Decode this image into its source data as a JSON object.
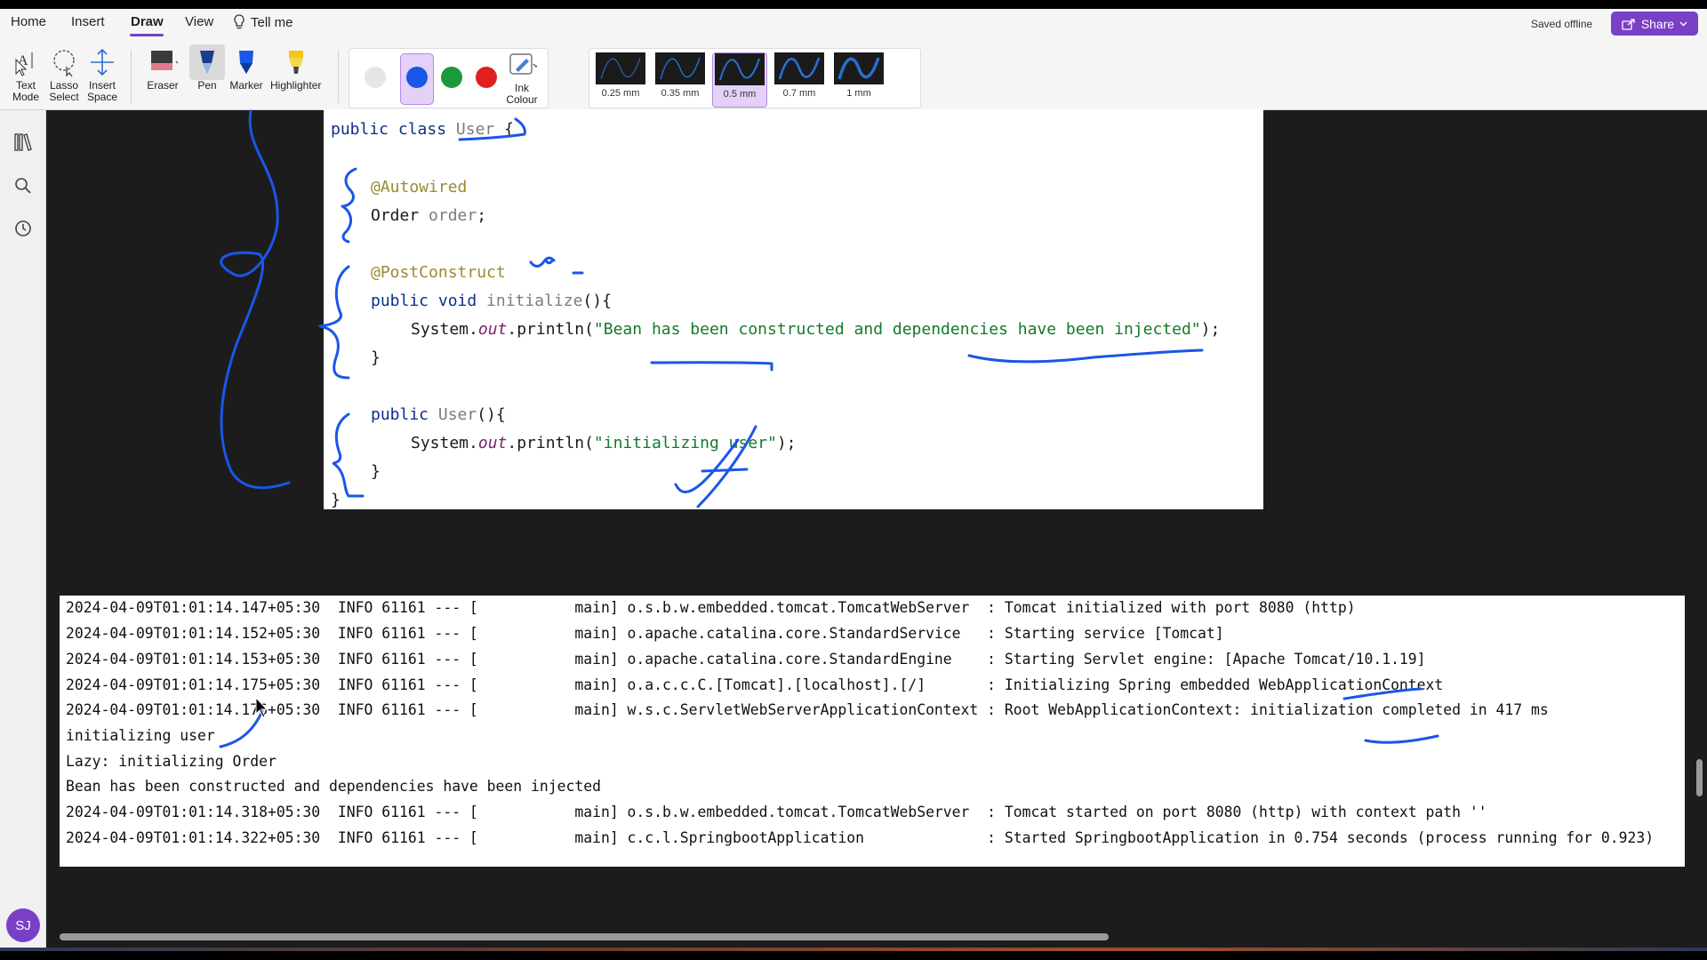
{
  "ribbon": {
    "tabs": [
      "Home",
      "Insert",
      "Draw",
      "View"
    ],
    "tell_me": "Tell me",
    "saved_status": "Saved offline",
    "share_label": "Share",
    "tools": {
      "text_mode": [
        "Text",
        "Mode"
      ],
      "lasso_select": [
        "Lasso",
        "Select"
      ],
      "insert_space": [
        "Insert",
        "Space"
      ],
      "eraser": "Eraser",
      "pen": "Pen",
      "marker": "Marker",
      "highlighter": "Highlighter",
      "ink_colour": [
        "Ink",
        "Colour"
      ]
    },
    "pen_colors": [
      "#e6e6e6",
      "#1a56e8",
      "#1a9a3a",
      "#e02020"
    ],
    "selected_color": "#1a56e8",
    "thicknesses": [
      "0.25 mm",
      "0.35 mm",
      "0.5 mm",
      "0.7 mm",
      "1 mm"
    ],
    "selected_thickness": "0.5 mm"
  },
  "user_initials": "SJ",
  "code": {
    "l1_kw": "public class ",
    "l1_cls": "User",
    "l1_end": " {",
    "l2_ann": "@Autowired",
    "l3_type": "Order ",
    "l3_field": "order",
    "l3_end": ";",
    "l4_ann": "@PostConstruct",
    "l5_kw": "public void ",
    "l5_method": "initialize",
    "l5_end": "(){",
    "l6_pre": "System.",
    "l6_out": "out",
    "l6_mid": ".println(",
    "l6_str": "\"Bean has been constructed and dependencies have been injected\"",
    "l6_end": ");",
    "l7": "}",
    "l8_kw": "public ",
    "l8_cls": "User",
    "l8_end": "(){",
    "l9_pre": "System.",
    "l9_out": "out",
    "l9_mid": ".println(",
    "l9_str": "\"initializing user\"",
    "l9_end": ");",
    "l10": "}",
    "l11": "}"
  },
  "console": [
    "2024-04-09T01:01:14.147+05:30  INFO 61161 --- [           main] o.s.b.w.embedded.tomcat.TomcatWebServer  : Tomcat initialized with port 8080 (http)",
    "2024-04-09T01:01:14.152+05:30  INFO 61161 --- [           main] o.apache.catalina.core.StandardService   : Starting service [Tomcat]",
    "2024-04-09T01:01:14.153+05:30  INFO 61161 --- [           main] o.apache.catalina.core.StandardEngine    : Starting Servlet engine: [Apache Tomcat/10.1.19]",
    "2024-04-09T01:01:14.175+05:30  INFO 61161 --- [           main] o.a.c.c.C.[Tomcat].[localhost].[/]       : Initializing Spring embedded WebApplicationContext",
    "2024-04-09T01:01:14.176+05:30  INFO 61161 --- [           main] w.s.c.ServletWebServerApplicationContext : Root WebApplicationContext: initialization completed in 417 ms",
    "initializing user",
    "Lazy: initializing Order",
    "Bean has been constructed and dependencies have been injected",
    "2024-04-09T01:01:14.318+05:30  INFO 61161 --- [           main] o.s.b.w.embedded.tomcat.TomcatWebServer  : Tomcat started on port 8080 (http) with context path ''",
    "2024-04-09T01:01:14.322+05:30  INFO 61161 --- [           main] c.c.l.SpringbootApplication              : Started SpringbootApplication in 0.754 seconds (process running for 0.923)"
  ],
  "colors": {
    "accent": "#7a3fc7",
    "ink": "#1a56e8"
  }
}
